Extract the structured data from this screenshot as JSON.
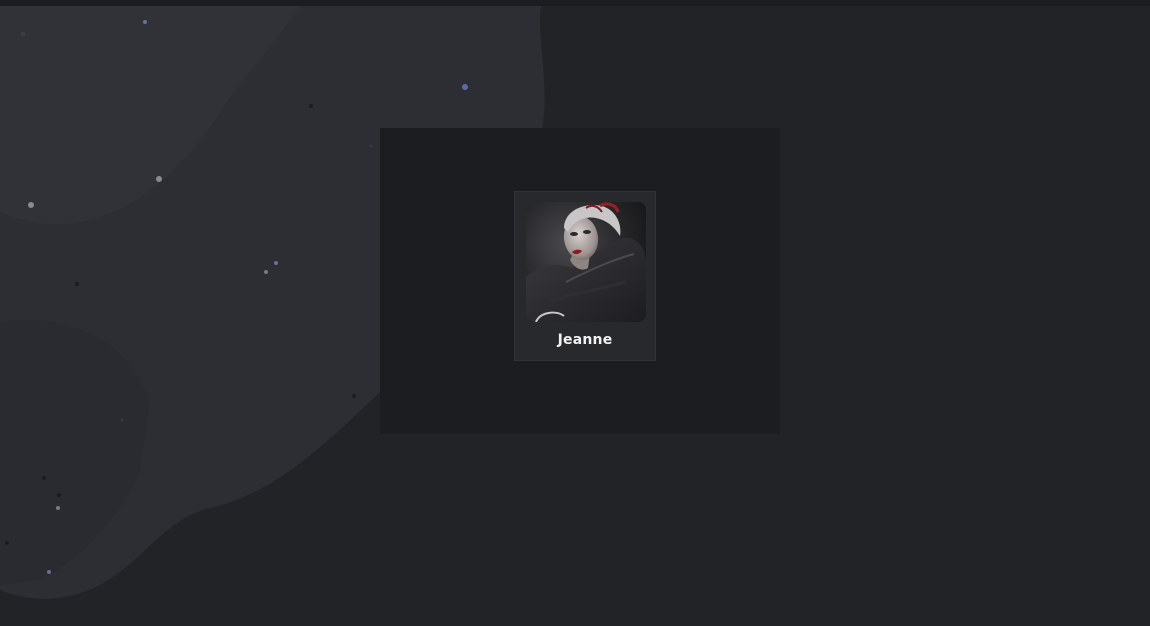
{
  "character_card": {
    "name": "Jeanne",
    "portrait_icon": "character-portrait"
  },
  "colors": {
    "background": "#222327",
    "modal": "#1c1d21",
    "card": "#28292d",
    "name_text": "#f2f2f2"
  }
}
